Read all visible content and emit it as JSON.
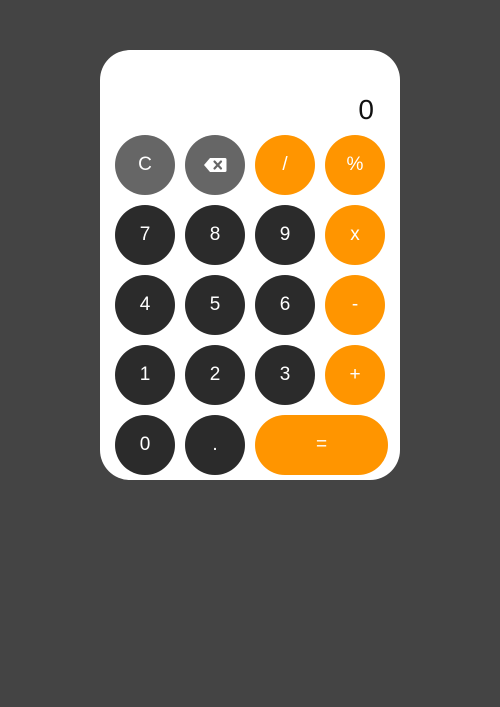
{
  "display": {
    "value": "0"
  },
  "keys": {
    "clear": "C",
    "backspace_icon": "backspace-icon",
    "divide": "/",
    "percent": "%",
    "seven": "7",
    "eight": "8",
    "nine": "9",
    "multiply": "x",
    "four": "4",
    "five": "5",
    "six": "6",
    "subtract": "-",
    "one": "1",
    "two": "2",
    "three": "3",
    "add": "+",
    "zero": "0",
    "decimal": ".",
    "equals": "="
  },
  "colors": {
    "background": "#444444",
    "panel": "#ffffff",
    "function_key": "#666666",
    "number_key": "#2b2b2b",
    "operator_key": "#ff9500"
  }
}
